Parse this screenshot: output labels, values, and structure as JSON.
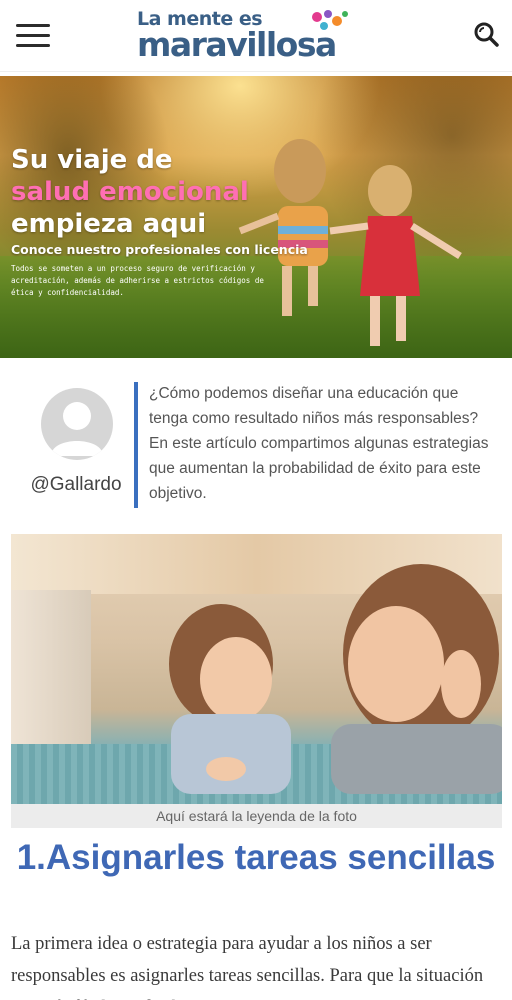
{
  "header": {
    "logo_top": "La mente es",
    "logo_bottom": "maravillosa",
    "menu_icon": "hamburger-menu-icon",
    "search_icon": "search-icon"
  },
  "hero": {
    "title_line1": "Su viaje de",
    "title_line2": "salud emocional",
    "title_line3": "empieza aqui",
    "subtitle": "Conoce nuestro profesionales con licencia",
    "small_text": "Todos se someten a un proceso seguro de verificación y acreditación, además de adherirse a estrictos códigos de ética y confidencialidad.",
    "accent_color": "#ff6fb3"
  },
  "author": {
    "handle": "@Gallardo",
    "avatar_icon": "user-avatar-icon"
  },
  "intro": {
    "text": "¿Cómo podemos diseñar una educación que tenga como resultado niños más responsables? En este artículo compartimos algunas estrategias que aumentan la probabilidad de éxito para este objetivo."
  },
  "figure": {
    "caption": "Aquí estará la leyenda de la foto"
  },
  "article": {
    "heading": "1.Asignarles tareas sencillas",
    "paragraph": "La primera idea o estrategia para ayudar a los niños a ser responsables es asignarles tareas sencillas. Para que la situación sea más fácil, puedes hacer que...",
    "heading_color": "#3f68b5"
  }
}
